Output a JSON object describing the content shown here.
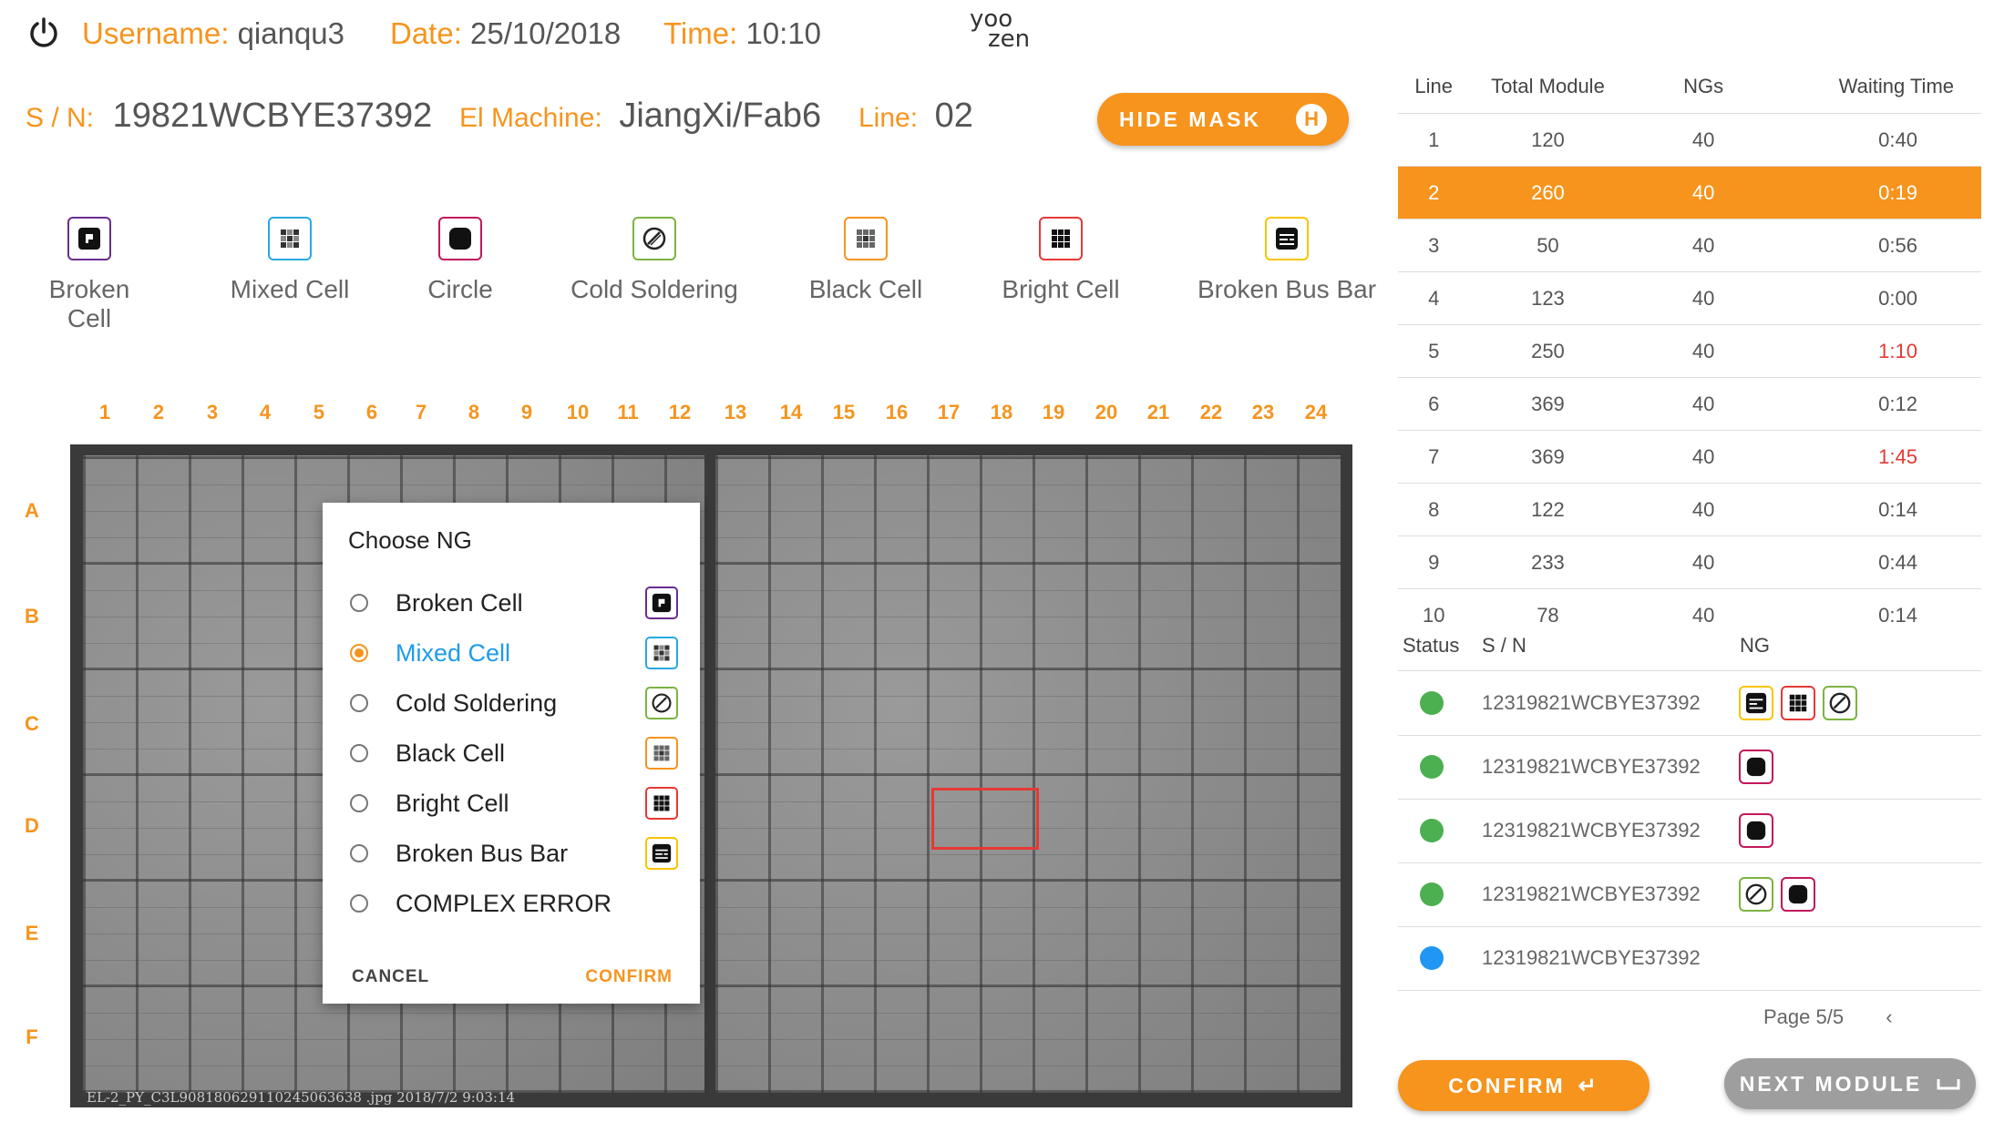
{
  "header": {
    "username_label": "Username:",
    "username": "qianqu3",
    "date_label": "Date:",
    "date": "25/10/2018",
    "time_label": "Time:",
    "time": "10:10",
    "logo_top": "yoo",
    "logo_bottom": "zen",
    "sn_label": "S / N:",
    "sn": "19821WCBYE37392",
    "machine_label": "El Machine:",
    "machine": "JiangXi/Fab6",
    "line_label": "Line:",
    "line": "02",
    "hide_mask_label": "HIDE MASK",
    "hide_mask_key": "H"
  },
  "defect_types": [
    {
      "label": "Broken Cell",
      "icon": "broken-cell-icon",
      "color": "#6a2c91"
    },
    {
      "label": "Mixed Cell",
      "icon": "mixed-cell-icon",
      "color": "#29a8e0"
    },
    {
      "label": "Circle",
      "icon": "circle-icon",
      "color": "#c2185b"
    },
    {
      "label": "Cold Soldering",
      "icon": "cold-soldering-icon",
      "color": "#7cb342"
    },
    {
      "label": "Black Cell",
      "icon": "black-cell-icon",
      "color": "#f7941d"
    },
    {
      "label": "Bright Cell",
      "icon": "bright-cell-icon",
      "color": "#e53935"
    },
    {
      "label": "Broken Bus Bar",
      "icon": "broken-bus-bar-icon",
      "color": "#f9c400"
    }
  ],
  "grid": {
    "columns": [
      "1",
      "2",
      "3",
      "4",
      "5",
      "6",
      "7",
      "8",
      "9",
      "10",
      "11",
      "12",
      "13",
      "14",
      "15",
      "16",
      "17",
      "18",
      "19",
      "20",
      "21",
      "22",
      "23",
      "24"
    ],
    "rows": [
      "A",
      "B",
      "C",
      "D",
      "E",
      "F"
    ],
    "image_caption": "EL-2_PY_C3L908180629110245063638 .jpg 2018/7/2 9:03:14"
  },
  "dialog": {
    "title": "Choose NG",
    "options": [
      {
        "label": "Broken Cell",
        "selected": false
      },
      {
        "label": "Mixed Cell",
        "selected": true
      },
      {
        "label": "Cold Soldering",
        "selected": false
      },
      {
        "label": "Black Cell",
        "selected": false
      },
      {
        "label": "Bright Cell",
        "selected": false
      },
      {
        "label": "Broken Bus Bar",
        "selected": false
      },
      {
        "label": "COMPLEX ERROR",
        "selected": false
      }
    ],
    "cancel_label": "CANCEL",
    "confirm_label": "CONFIRM"
  },
  "lines_table": {
    "headers": [
      "Line",
      "Total Module",
      "NGs",
      "Waiting Time"
    ],
    "rows": [
      {
        "line": "1",
        "total": "120",
        "ngs": "40",
        "wait": "0:40",
        "alert": false,
        "selected": false
      },
      {
        "line": "2",
        "total": "260",
        "ngs": "40",
        "wait": "0:19",
        "alert": false,
        "selected": true
      },
      {
        "line": "3",
        "total": "50",
        "ngs": "40",
        "wait": "0:56",
        "alert": false,
        "selected": false
      },
      {
        "line": "4",
        "total": "123",
        "ngs": "40",
        "wait": "0:00",
        "alert": false,
        "selected": false
      },
      {
        "line": "5",
        "total": "250",
        "ngs": "40",
        "wait": "1:10",
        "alert": true,
        "selected": false
      },
      {
        "line": "6",
        "total": "369",
        "ngs": "40",
        "wait": "0:12",
        "alert": false,
        "selected": false
      },
      {
        "line": "7",
        "total": "369",
        "ngs": "40",
        "wait": "1:45",
        "alert": true,
        "selected": false
      },
      {
        "line": "8",
        "total": "122",
        "ngs": "40",
        "wait": "0:14",
        "alert": false,
        "selected": false
      },
      {
        "line": "9",
        "total": "233",
        "ngs": "40",
        "wait": "0:44",
        "alert": false,
        "selected": false
      },
      {
        "line": "10",
        "total": "78",
        "ngs": "40",
        "wait": "0:14",
        "alert": false,
        "selected": false
      }
    ]
  },
  "status_table": {
    "headers": [
      "Status",
      "S / N",
      "NG"
    ],
    "rows": [
      {
        "status_color": "#4caf50",
        "sn": "12319821WCBYE37392",
        "ngs": [
          "broken-bus-bar-icon",
          "bright-cell-icon",
          "cold-soldering-icon"
        ]
      },
      {
        "status_color": "#4caf50",
        "sn": "12319821WCBYE37392",
        "ngs": [
          "circle-icon"
        ]
      },
      {
        "status_color": "#4caf50",
        "sn": "12319821WCBYE37392",
        "ngs": [
          "circle-icon"
        ]
      },
      {
        "status_color": "#4caf50",
        "sn": "12319821WCBYE37392",
        "ngs": [
          "cold-soldering-icon",
          "circle-icon"
        ]
      },
      {
        "status_color": "#2196f3",
        "sn": "12319821WCBYE37392",
        "ngs": []
      }
    ],
    "page": "Page 5/5"
  },
  "footer": {
    "confirm_label": "CONFIRM",
    "next_label": "NEXT MODULE"
  }
}
